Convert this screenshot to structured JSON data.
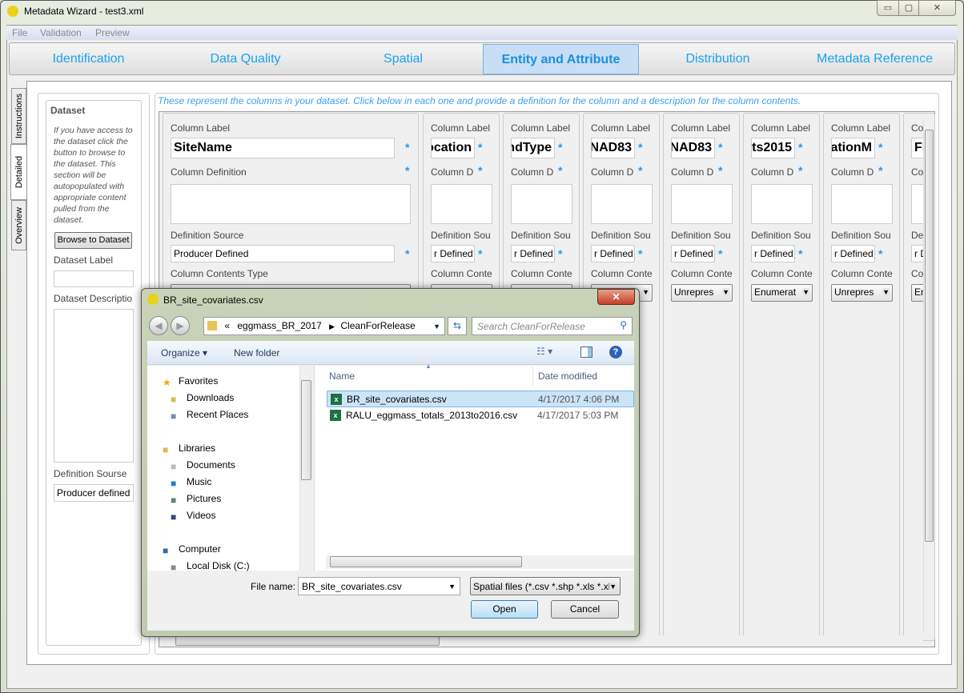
{
  "window": {
    "title": "Metadata Wizard - test3.xml",
    "minimize": "▭",
    "maximize": "▢",
    "close": "✕"
  },
  "menu": [
    "File",
    "Validation",
    "Preview"
  ],
  "tabs": [
    {
      "label": "Identification"
    },
    {
      "label": "Data Quality"
    },
    {
      "label": "Spatial"
    },
    {
      "label": "Entity and Attribute",
      "active": true
    },
    {
      "label": "Distribution"
    },
    {
      "label": "Metadata Reference"
    }
  ],
  "side_tabs": [
    "Instructions",
    "Detailed",
    "Overview"
  ],
  "dataset": {
    "heading": "Dataset",
    "help": "If you have access to the dataset click the button to browse to the dataset.  This section will be autopopulated with appropriate content pulled from the dataset.",
    "browse_button": "Browse to Dataset",
    "label_label": "Dataset Label",
    "label_value": "",
    "description_label": "Dataset Descriptio",
    "definition_source_label": "Definition Sourse",
    "definition_source_value": "Producer defined"
  },
  "instructions": "These represent the columns in your dataset. Click below in each one and provide a definition for the column and a description for the column contents.",
  "columns": [
    {
      "label_caption": "Column Label",
      "label": "SiteName",
      "def_caption": "Column Definition",
      "src_caption": "Definition Source",
      "src": "Producer Defined",
      "type_caption": "Column Contents Type",
      "type": ""
    },
    {
      "label_caption": "Column Label",
      "label": "ocation",
      "def_caption": "Column D",
      "src_caption": "Definition Sou",
      "src": "r Defined",
      "type_caption": "Column Conte",
      "type": ""
    },
    {
      "label_caption": "Column Label",
      "label": "ndType",
      "def_caption": "Column D",
      "src_caption": "Definition Sou",
      "src": "r Defined",
      "type_caption": "Column Conte",
      "type": ""
    },
    {
      "label_caption": "Column Label",
      "label": "NAD83",
      "def_caption": "Column D",
      "src_caption": "Definition Sou",
      "src": "r Defined",
      "type_caption": "Column Conte",
      "type": ""
    },
    {
      "label_caption": "Column Label",
      "label": "NAD83",
      "def_caption": "Column D",
      "src_caption": "Definition Sou",
      "src": "r Defined",
      "type_caption": "Column Conte",
      "type": "Unrepres"
    },
    {
      "label_caption": "Column Label",
      "label": "ts2015",
      "def_caption": "Column D",
      "src_caption": "Definition Sou",
      "src": "r Defined",
      "type_caption": "Column Conte",
      "type": "Enumerat"
    },
    {
      "label_caption": "Column Label",
      "label": "ationM",
      "def_caption": "Column D",
      "src_caption": "Definition Sou",
      "src": "r Defined",
      "type_caption": "Column Conte",
      "type": "Unrepres"
    },
    {
      "label_caption": "Co",
      "label": "Fl",
      "def_caption": "Co",
      "src_caption": "De",
      "src": "r D",
      "type_caption": "Co",
      "type": "En"
    }
  ],
  "required_mark": "*",
  "dialog": {
    "title": "BR_site_covariates.csv",
    "close": "✕",
    "breadcrumb": {
      "prefix": "«",
      "parent": "eggmass_BR_2017",
      "current": "CleanForRelease"
    },
    "search_placeholder": "Search CleanForRelease",
    "toolbar": {
      "organize": "Organize ▾",
      "new_folder": "New folder"
    },
    "nav": {
      "favorites": "Favorites",
      "favorites_items": [
        "Downloads",
        "Recent Places"
      ],
      "libraries": "Libraries",
      "libraries_items": [
        "Documents",
        "Music",
        "Pictures",
        "Videos"
      ],
      "computer": "Computer",
      "computer_items": [
        "Local Disk (C:)"
      ]
    },
    "list_headers": {
      "name": "Name",
      "date": "Date modified"
    },
    "files": [
      {
        "name": "BR_site_covariates.csv",
        "date": "4/17/2017 4:06 PM",
        "selected": true
      },
      {
        "name": "RALU_eggmass_totals_2013to2016.csv",
        "date": "4/17/2017 5:03 PM",
        "selected": false
      }
    ],
    "file_name_label": "File name:",
    "file_name_value": "BR_site_covariates.csv",
    "filter": "Spatial files (*.csv *.shp *.xls *.xl",
    "open": "Open",
    "cancel": "Cancel"
  },
  "colors": {
    "accent": "#1aa3ee",
    "required": "#2a95f0",
    "selected_row": "#cce4f7"
  }
}
